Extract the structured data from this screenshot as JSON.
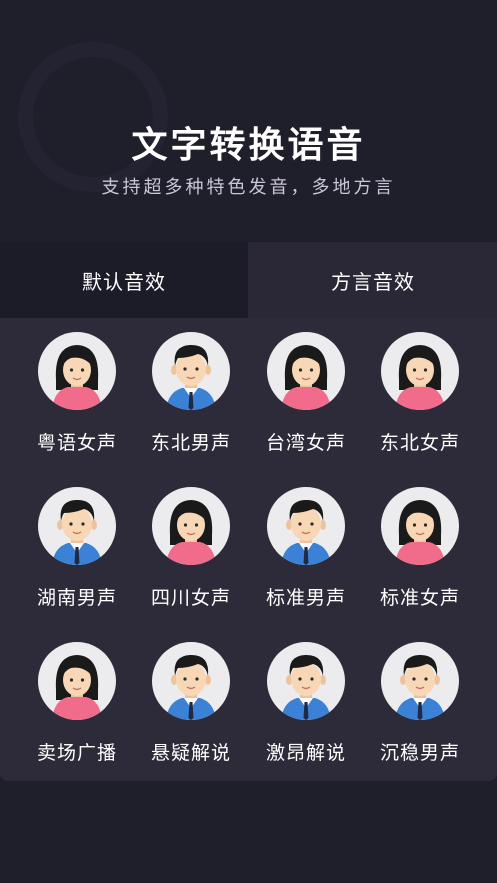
{
  "hero": {
    "title": "文字转换语音",
    "subtitle": "支持超多种特色发音，多地方言"
  },
  "tabs": [
    {
      "label": "默认音效",
      "active": true
    },
    {
      "label": "方言音效",
      "active": false
    }
  ],
  "voices": [
    {
      "label": "粤语女声",
      "avatar": "female-avatar-icon"
    },
    {
      "label": "东北男声",
      "avatar": "male-avatar-icon"
    },
    {
      "label": "台湾女声",
      "avatar": "female-avatar-icon"
    },
    {
      "label": "东北女声",
      "avatar": "female-avatar-icon"
    },
    {
      "label": "湖南男声",
      "avatar": "male-avatar-icon"
    },
    {
      "label": "四川女声",
      "avatar": "female-avatar-icon"
    },
    {
      "label": "标准男声",
      "avatar": "male-avatar-icon"
    },
    {
      "label": "标准女声",
      "avatar": "female-avatar-icon"
    },
    {
      "label": "卖场广播",
      "avatar": "female-avatar-icon"
    },
    {
      "label": "悬疑解说",
      "avatar": "male-avatar-icon"
    },
    {
      "label": "激昂解说",
      "avatar": "male-avatar-icon"
    },
    {
      "label": "沉稳男声",
      "avatar": "male-avatar-icon"
    }
  ],
  "colors": {
    "background": "#1f1e2b",
    "panel": "#2d2b39",
    "female_top": "#f06c8a",
    "male_shirt": "#3b82d6",
    "hair": "#1a1a1a",
    "skin": "#f7d7b5"
  }
}
